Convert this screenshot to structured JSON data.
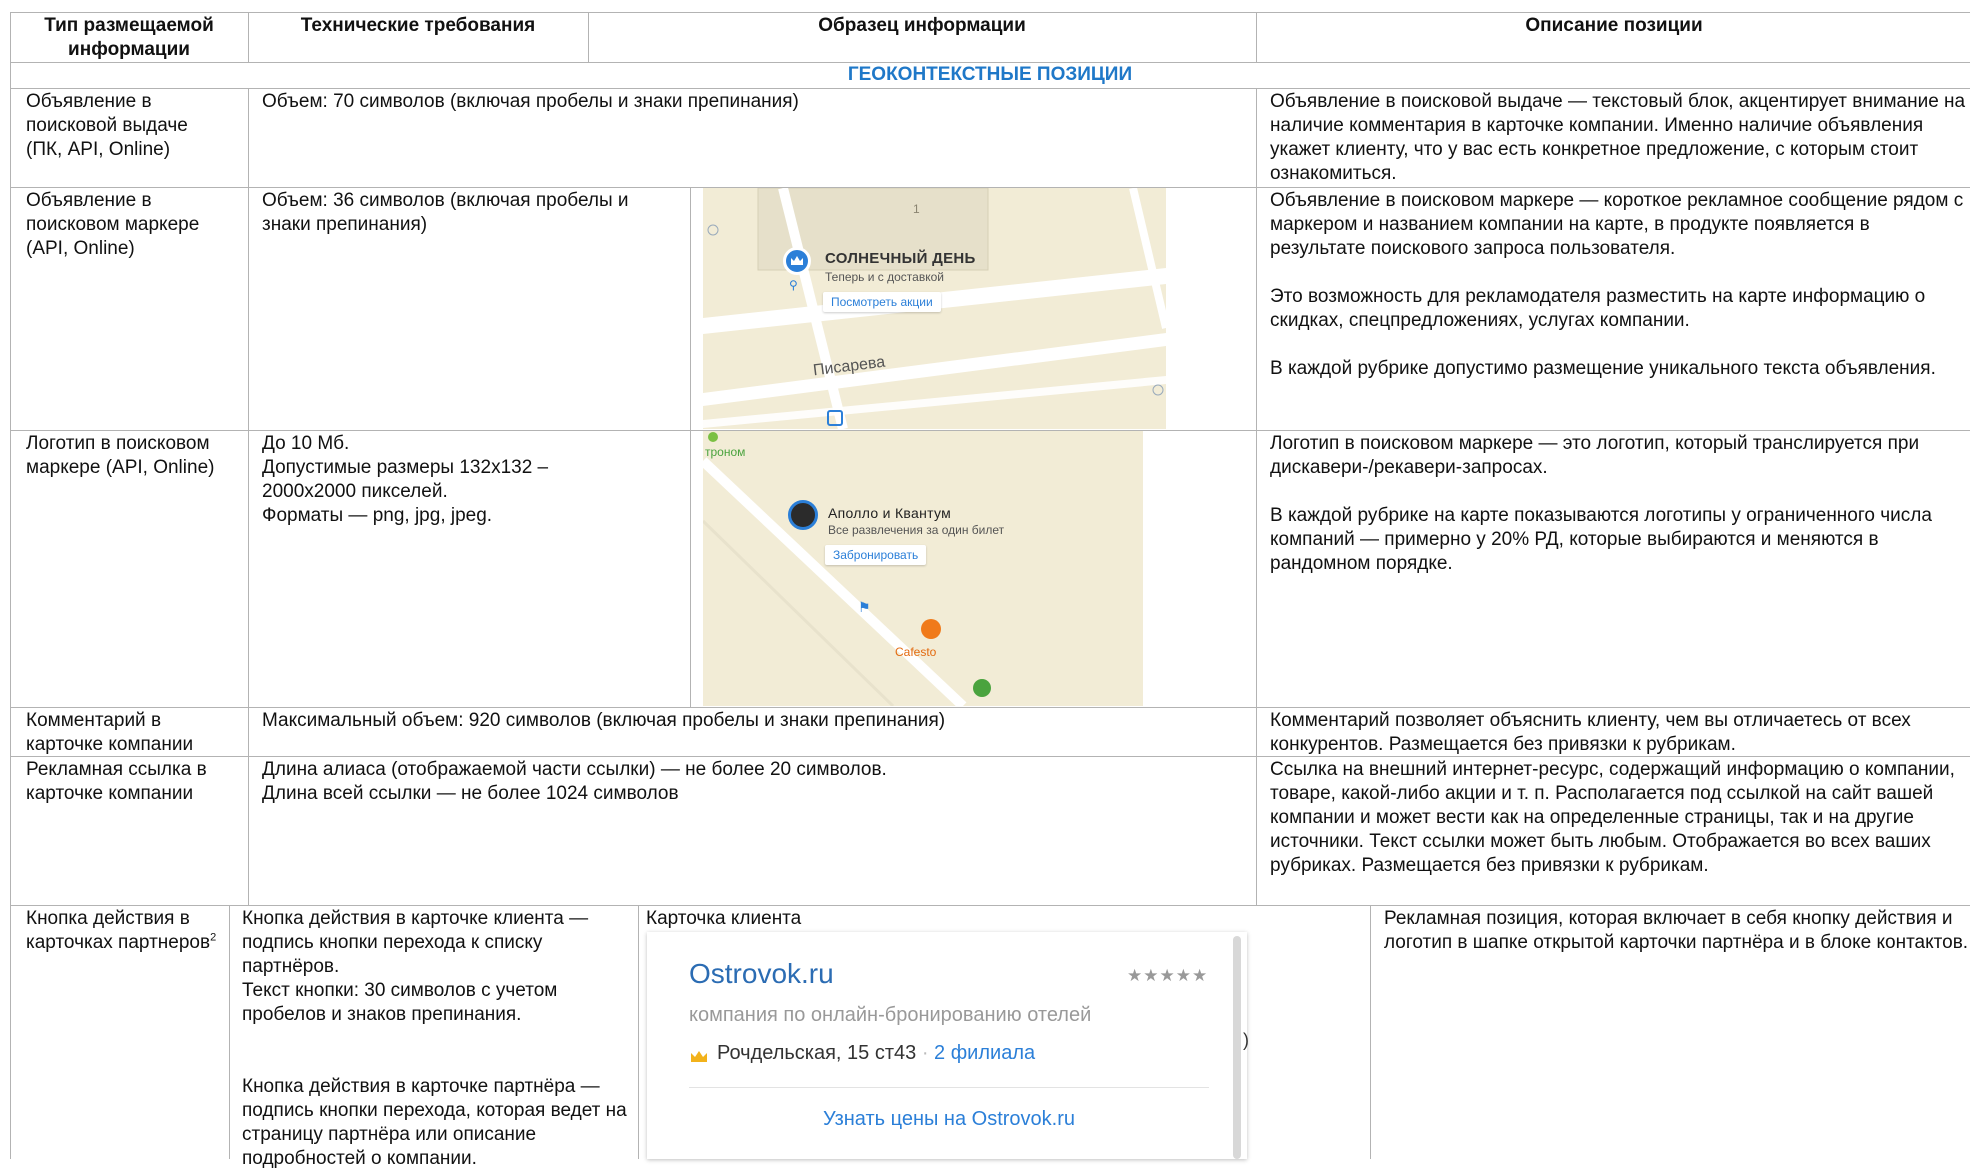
{
  "headers": {
    "col1": "Тип размещаемой информации",
    "col2": "Технические требования",
    "col3": "Образец информации",
    "col4": "Описание позиции"
  },
  "section_title": "ГЕОКОНТЕКСТНЫЕ ПОЗИЦИИ",
  "rows": [
    {
      "type": "Объявление в поисковой выдаче (ПК, API, Online)",
      "requirements": "Объем: 70 символов (включая пробелы и знаки препинания)",
      "description": "Объявление в поисковой выдаче — текстовый блок, акцентирует внимание на наличие комментария в карточке компании. Именно наличие объявления укажет клиенту, что у вас есть конкретное предложение, с которым стоит ознакомиться."
    },
    {
      "type": "Объявление в поисковом маркере (API, Online)",
      "requirements": "Объем: 36 символов (включая пробелы и знаки препинания)",
      "description": "Объявление в поисковом маркере — короткое рекламное сообщение рядом с маркером и названием компании на карте, в продукте появляется в результате поискового запроса пользователя.\n\nЭто возможность для рекламодателя разместить на карте информацию о скидках, спецпредложениях, услугах компании.\n\nВ каждой рубрике допустимо размещение уникального текста объявления.",
      "sample": {
        "building_number": "1",
        "company": "СОЛНЕЧНЫЙ ДЕНЬ",
        "ad_text": "Теперь и с доставкой",
        "button": "Посмотреть акции",
        "street": "Писарева"
      }
    },
    {
      "type": "Логотип в поисковом маркере (API, Online)",
      "requirements": "До 10 Мб.\nДопустимые размеры 132х132 –\n2000х2000 пикселей.\nФорматы — png, jpg, jpeg.",
      "description": "Логотип в поисковом маркере — это логотип, который транслируется при дискавери-/рекавери-запросах.\n\nВ каждой рубрике на карте показываются логотипы у ограниченного числа компаний — примерно у 20% РД, которые выбираются и меняются в рандомном порядке.",
      "sample": {
        "corner_label": "троном",
        "company": "Аполло и Квантум",
        "ad_text": "Все развлечения за один билет",
        "button": "Забронировать",
        "poi": "Cafesto"
      }
    },
    {
      "type": "Комментарий в карточке компании",
      "requirements": "Максимальный объем: 920 символов (включая пробелы и знаки препинания)",
      "description": "Комментарий позволяет объяснить клиенту, чем вы отличаетесь от всех конкурентов. Размещается без привязки к рубрикам."
    },
    {
      "type": "Рекламная ссылка в карточке компании",
      "requirements": "Длина алиаса (отображаемой части ссылки) — не более 20 символов.\nДлина всей ссылки — не более 1024 символов",
      "description": "Ссылка на внешний интернет-ресурс, содержащий информацию о компании, товаре, какой-либо акции и т. п. Располагается под ссылкой на сайт вашей компании и может вести как на определенные страницы, так и на другие источники. Текст ссылки может быть любым. Отображается во всех ваших рубриках. Размещается без привязки к рубрикам."
    },
    {
      "type_main": "Кнопка действия в карточках партнеров",
      "type_sup": "2",
      "requirements": "Кнопка действия в карточке клиента — подпись кнопки перехода к списку партнёров.\nТекст кнопки: 30 символов с учетом пробелов и знаков препинания.\n\n\nКнопка действия в карточке партнёра — подпись кнопки перехода, которая ведет на страницу партнёра или описание подробностей о компании.",
      "sample_caption": "Карточка клиента",
      "card": {
        "name": "Ostrovok.ru",
        "rating": "★★★★★",
        "subtitle": "компания по онлайн-бронированию отелей",
        "address": "Рочдельская, 15 ст43",
        "separator": "·",
        "branches": "2 филиала",
        "action_button": "Узнать цены на Ostrovok.ru"
      },
      "description": "Рекламная позиция, которая включает в себя кнопку действия и логотип в шапке открытой карточки партнёра и в блоке контактов."
    }
  ],
  "colors": {
    "section": "#1f78c8",
    "grid": "#b3b3b3",
    "map_bg": "#f2ecd6",
    "link_blue": "#2b7fd8",
    "card_title": "#2b6cb3"
  }
}
